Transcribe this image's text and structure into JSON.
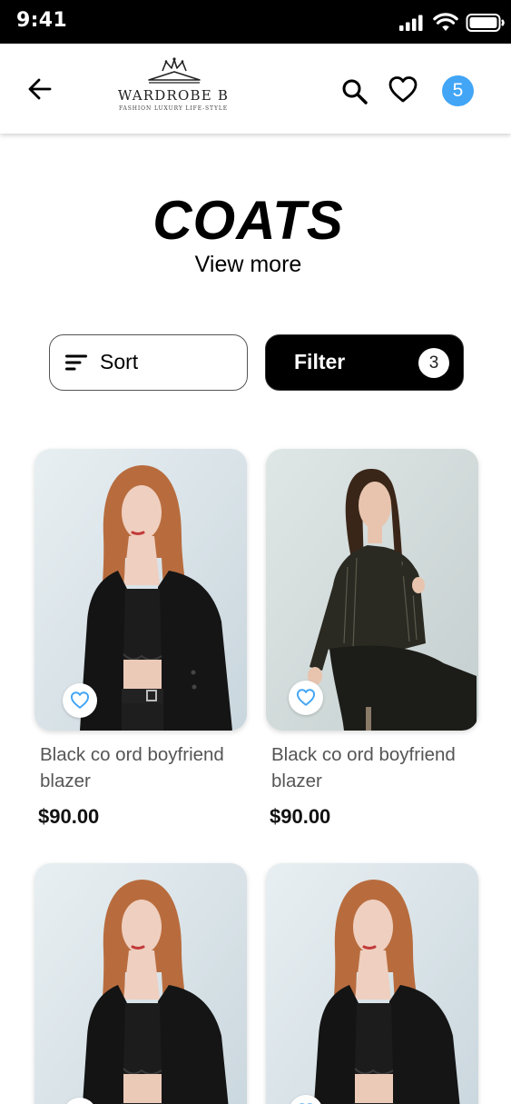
{
  "status_bar": {
    "time": "9:41"
  },
  "header": {
    "logo_name": "WARDROBE B",
    "logo_tagline": "FASHION LUXURY LIFE-STYLE",
    "cart_count": "5"
  },
  "page": {
    "title": "COATS",
    "view_more": "View more"
  },
  "controls": {
    "sort_label": "Sort",
    "filter_label": "Filter",
    "filter_count": "3"
  },
  "products": [
    {
      "name": "Black co ord boyfriend blazer",
      "price": "$90.00"
    },
    {
      "name": "Black co ord boyfriend blazer",
      "price": "$90.00"
    },
    {
      "name": "",
      "price": ""
    },
    {
      "name": "",
      "price": ""
    }
  ],
  "colors": {
    "accent": "#42a5f5",
    "primary": "#000000",
    "favorite_icon": "#42a5f5"
  },
  "icons": [
    "back-arrow-icon",
    "search-icon",
    "heart-icon",
    "sort-icon",
    "signal-icon",
    "wifi-icon",
    "battery-icon"
  ]
}
